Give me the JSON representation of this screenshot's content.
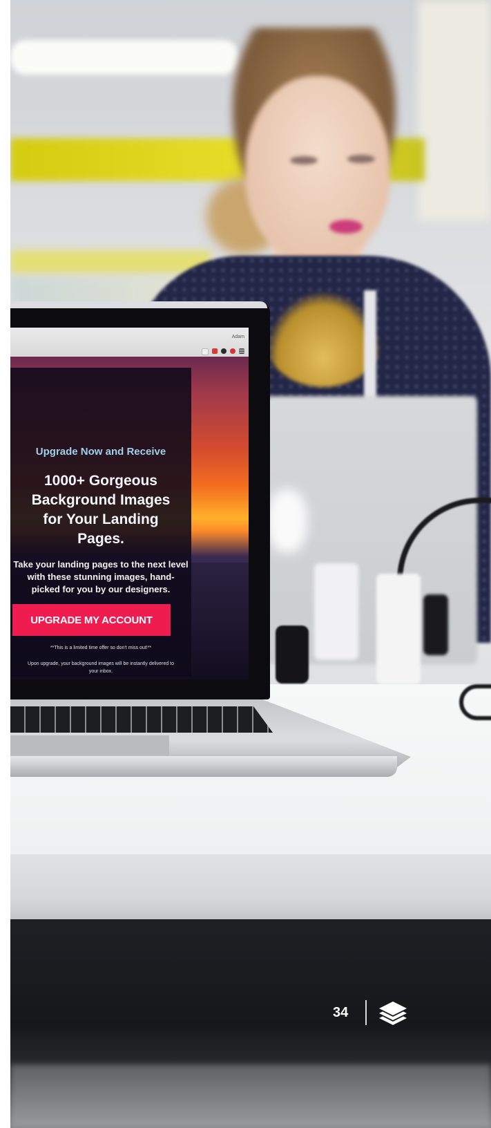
{
  "photo": {
    "description_tags": []
  },
  "laptop_screen": {
    "browser_user": "Adam",
    "eyebrow": "Upgrade Now and Receive",
    "headline": "1000+ Gorgeous Background Images for Your Landing Pages.",
    "subtext": "Take your landing pages to the next level with these stunning images, hand-picked for you by our designers.",
    "cta_label": "UPGRADE MY ACCOUNT",
    "note": "**This is a limited time offer so don't miss out!**",
    "upgrade_info": "Upon upgrade, your background images will be instantly delivered to your inbox.",
    "cta_color": "#ef1c4f"
  },
  "footer": {
    "page_number": "34",
    "logo_icon": "layers-icon"
  }
}
